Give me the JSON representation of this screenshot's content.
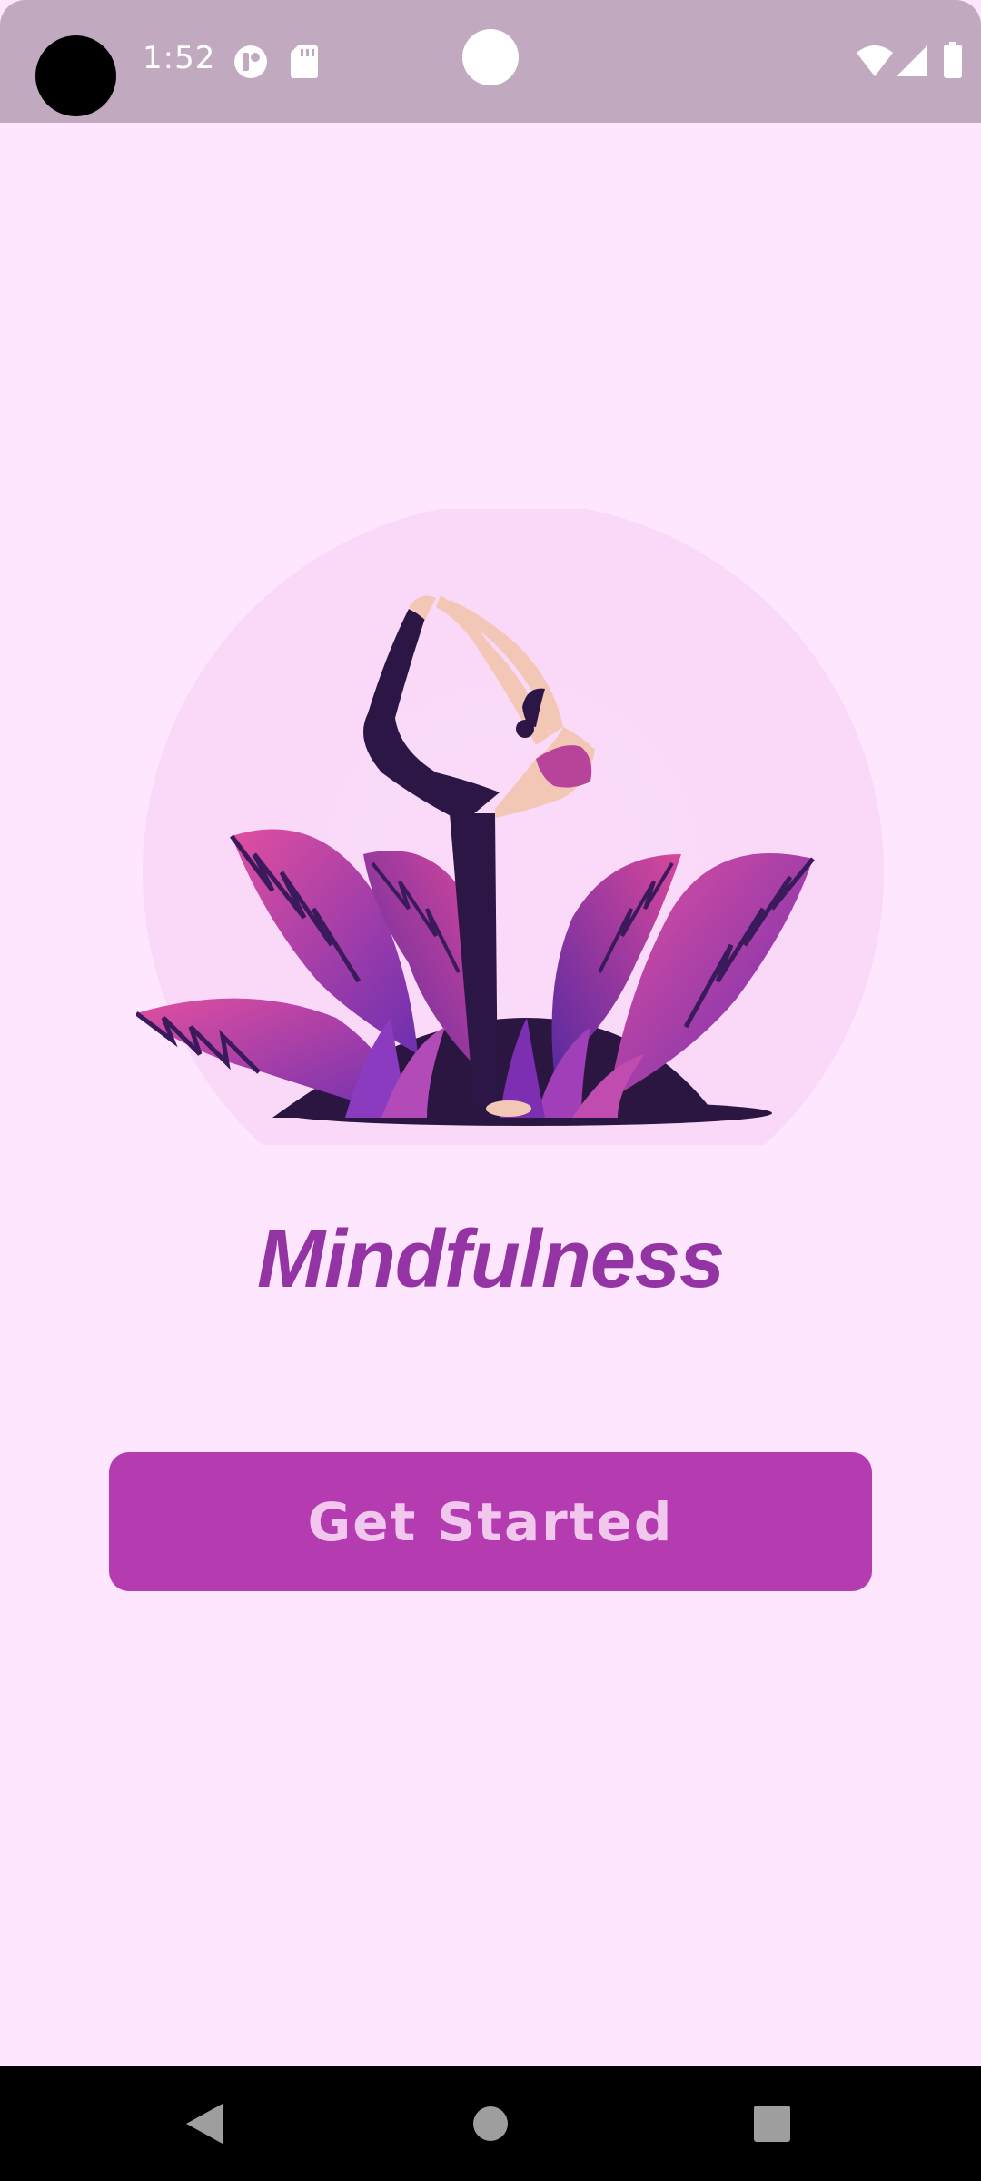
{
  "status_bar": {
    "time": "1:52",
    "icons": [
      "camera-cutout-icon",
      "notification-app-icon",
      "sd-card-icon",
      "wifi-icon",
      "cellular-signal-icon",
      "battery-icon"
    ]
  },
  "illustration": {
    "icon": "yoga-pose-illustration"
  },
  "main": {
    "title": "Mindfulness",
    "button_label": "Get Started"
  },
  "nav_bar": {
    "icons": [
      "back-icon",
      "home-icon",
      "recents-icon"
    ]
  },
  "colors": {
    "background": "#fde6fe",
    "status_bar": "#c1aac0",
    "title": "#9433a3",
    "button": "#b43cb0",
    "button_text": "#f2c7ee"
  }
}
